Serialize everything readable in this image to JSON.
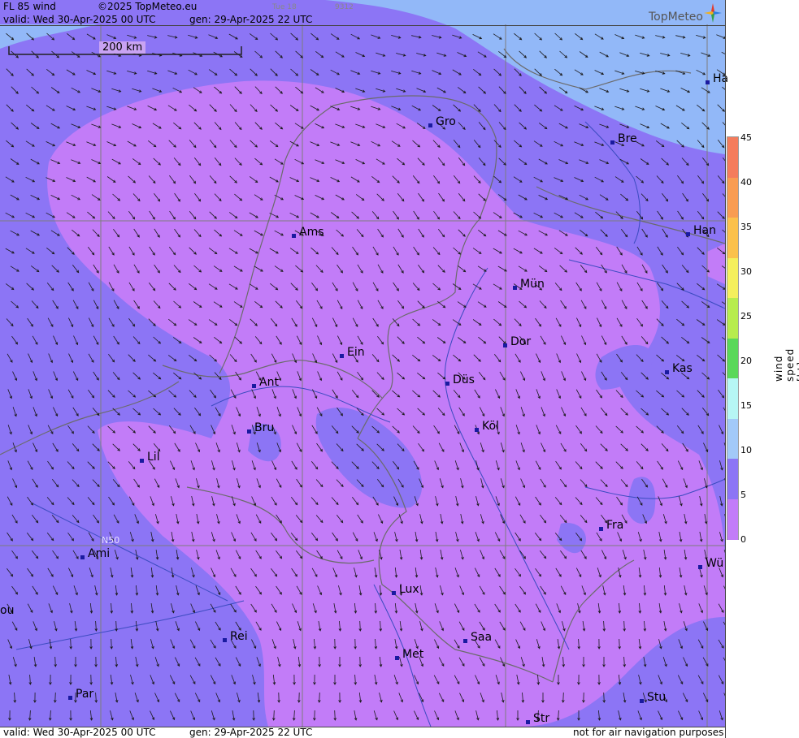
{
  "header": {
    "product": "FL 85 wind",
    "copyright": "©2025 TopMeteo.eu",
    "day_tab": "Tue 18",
    "code": "9312",
    "valid": "valid:  Wed  30-Apr-2025  00 UTC",
    "gen": "gen: 29-Apr-2025 22 UTC",
    "logo": "TopMeteo"
  },
  "map": {
    "scale_label": "200 km",
    "lat_label": "N50",
    "zones": {
      "calm": "#c27cf8",
      "light": "#8c75f5",
      "moderate": "#92b8f8",
      "border": "#6b6b6b",
      "river": "#3b4bc0",
      "grid": "#7d7d7d"
    },
    "cities": [
      {
        "name": "Gro"
      },
      {
        "name": "Bre"
      },
      {
        "name": "Ha"
      },
      {
        "name": "Ams"
      },
      {
        "name": "Han"
      },
      {
        "name": "Mün"
      },
      {
        "name": "Dor"
      },
      {
        "name": "Ein"
      },
      {
        "name": "Kas"
      },
      {
        "name": "Ant"
      },
      {
        "name": "Düs"
      },
      {
        "name": "Bru"
      },
      {
        "name": "Köl"
      },
      {
        "name": "Lil"
      },
      {
        "name": "Fra"
      },
      {
        "name": "Ami"
      },
      {
        "name": "Wü"
      },
      {
        "name": "Lux"
      },
      {
        "name": "ou"
      },
      {
        "name": "Rei"
      },
      {
        "name": "Saa"
      },
      {
        "name": "Met"
      },
      {
        "name": "Par"
      },
      {
        "name": "Stu"
      },
      {
        "name": "Str"
      }
    ]
  },
  "colorbar": {
    "label": "wind  speed  [kt]",
    "ticks": [
      "45",
      "40",
      "35",
      "30",
      "25",
      "20",
      "15",
      "10",
      "5",
      "0"
    ],
    "colors": [
      "#f47c5c",
      "#f89c52",
      "#fbc14c",
      "#f4ef5c",
      "#b7ec4e",
      "#5ad85a",
      "#b6f6f4",
      "#a2c9f8",
      "#8c75f5",
      "#c27cf8"
    ]
  },
  "footer": {
    "valid": "valid:  Wed  30-Apr-2025  00 UTC",
    "gen": "gen: 29-Apr-2025 22 UTC",
    "disclaimer": "not for air navigation purposes"
  }
}
